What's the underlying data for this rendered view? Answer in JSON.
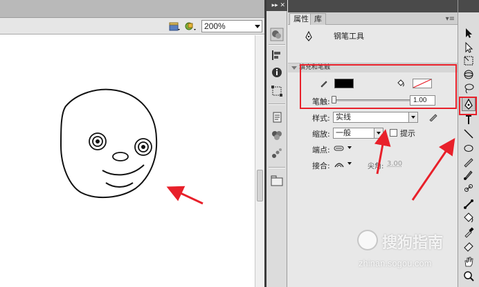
{
  "toolbar": {
    "zoom_value": "200%",
    "icons": [
      "edit-scene-icon",
      "edit-symbols-icon"
    ]
  },
  "panel": {
    "tabs": [
      {
        "label": "属性",
        "active": true
      },
      {
        "label": "库",
        "active": false
      }
    ],
    "tool_name": "钢笔工具",
    "section_fill_stroke": "填充和笔触",
    "stroke_color": "#000000",
    "fill_color": "none",
    "stroke_label": "笔触:",
    "stroke_value": "1.00",
    "style_label": "样式:",
    "style_value": "实线",
    "scale_label": "缩放:",
    "scale_value": "一般",
    "hint_label": "提示",
    "hint_checked": false,
    "cap_label": "端点:",
    "join_label": "接合:",
    "sharp_label": "尖角:",
    "sharp_value": "3.00"
  },
  "tools": [
    "selection-tool",
    "subselection-tool",
    "free-transform-tool",
    "3d-rotation-tool",
    "lasso-tool",
    "pen-tool",
    "text-tool",
    "line-tool",
    "oval-tool",
    "pencil-tool",
    "brush-tool",
    "deco-tool",
    "bone-tool",
    "paint-bucket-tool",
    "eyedropper-tool",
    "eraser-tool",
    "hand-tool",
    "zoom-tool"
  ],
  "highlights": {
    "color": "#e8202a"
  },
  "watermark": {
    "name": "搜狗指南",
    "url": "zhinan.sogou.com"
  }
}
